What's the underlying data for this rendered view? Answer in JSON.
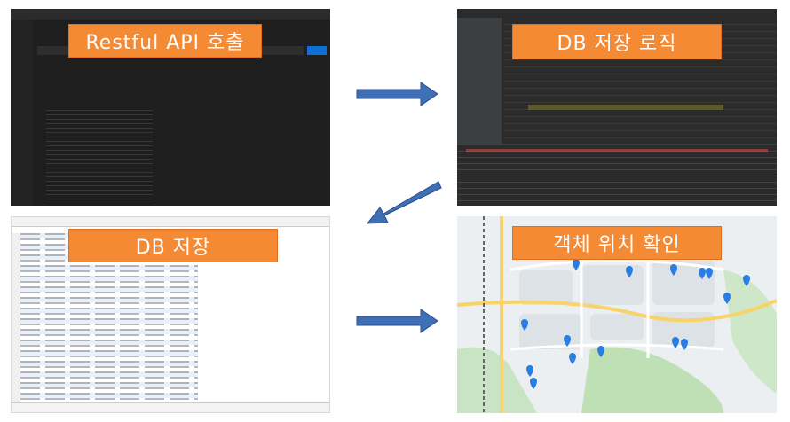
{
  "steps": [
    {
      "label": "Restful API 호출"
    },
    {
      "label": "DB 저장 로직"
    },
    {
      "label": "DB 저장"
    },
    {
      "label": "객체 위치 확인"
    }
  ],
  "colors": {
    "label_fill": "#f58a35",
    "label_text": "#ffffff",
    "arrow_fill": "#3f6fb5",
    "arrow_stroke": "#2b4f87"
  }
}
